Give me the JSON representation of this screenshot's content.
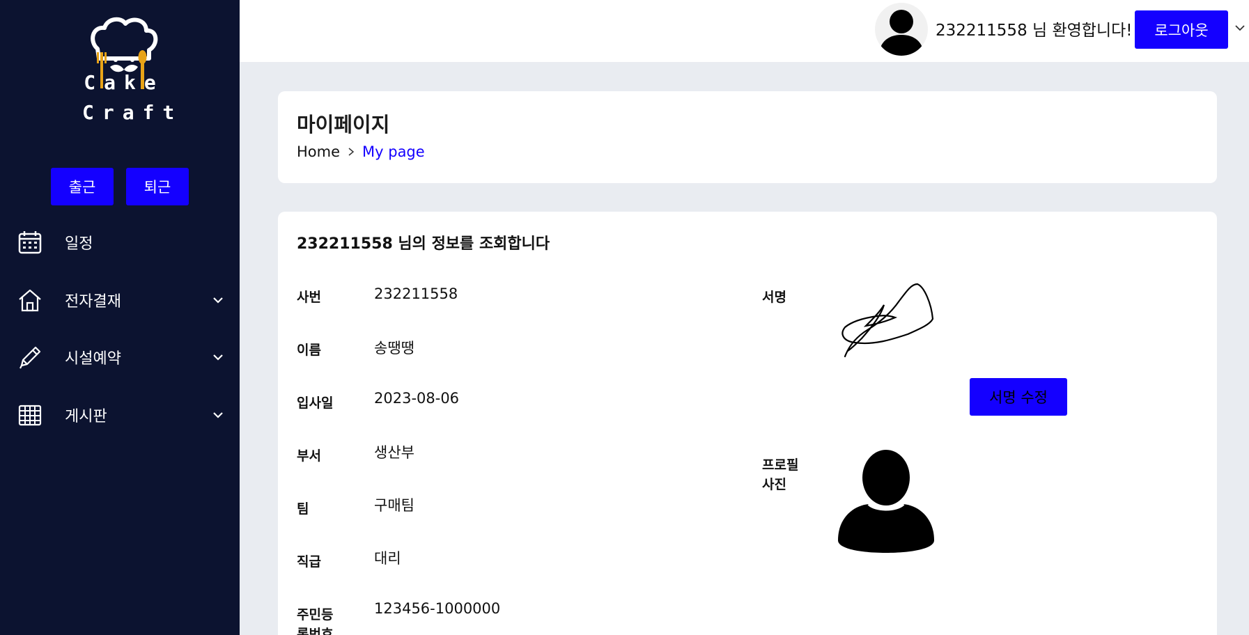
{
  "app": {
    "logo_line1": "Cake",
    "logo_line2": "Craft"
  },
  "sidebar": {
    "attendance": {
      "clock_in": "출근",
      "clock_out": "퇴근"
    },
    "items": [
      {
        "label": "일정",
        "icon": "calendar-icon",
        "expandable": false
      },
      {
        "label": "전자결재",
        "icon": "house-icon",
        "expandable": true
      },
      {
        "label": "시설예약",
        "icon": "pencil-icon",
        "expandable": true
      },
      {
        "label": "게시판",
        "icon": "board-grid-icon",
        "expandable": true
      }
    ]
  },
  "topbar": {
    "welcome": "232211558 님 환영합니다!",
    "logout": "로그아웃"
  },
  "page": {
    "title": "마이페이지",
    "breadcrumb": {
      "home": "Home",
      "current": "My page"
    }
  },
  "info": {
    "heading": "232211558 님의 정보를 조회합니다",
    "fields": [
      {
        "label": "사번",
        "value": "232211558"
      },
      {
        "label": "이름",
        "value": "송땡땡"
      },
      {
        "label": "입사일",
        "value": "2023-08-06"
      },
      {
        "label": "부서",
        "value": "생산부"
      },
      {
        "label": "팀",
        "value": "구매팀"
      },
      {
        "label": "직급",
        "value": "대리"
      },
      {
        "label": "주민등록번호",
        "value": "123456-1000000"
      }
    ],
    "signature_label": "서명",
    "signature_edit": "서명 수정",
    "profile_label": "프로필사진"
  },
  "colors": {
    "sidebar_bg": "#0c1330",
    "accent": "#1400ff",
    "page_bg": "#e9ecf1",
    "logo_gold": "#e8a317"
  }
}
